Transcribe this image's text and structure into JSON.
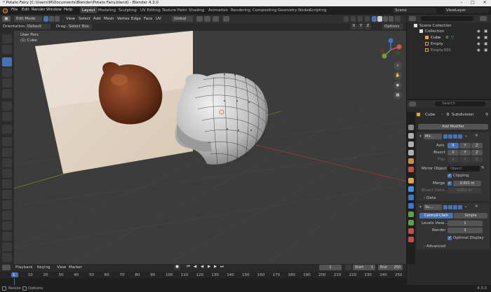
{
  "window": {
    "title": "* Potato Fairy [C:\\Users\\M\\Documents\\Blender\\Potato Fairy.blend] - Blender 4.3.0"
  },
  "menu": [
    "File",
    "Edit",
    "Render",
    "Window",
    "Help"
  ],
  "workspaces": [
    "Layout",
    "Modeling",
    "Sculpting",
    "UV Editing",
    "Texture Paint",
    "Shading",
    "Animation",
    "Rendering",
    "Compositing",
    "Geometry Nodes",
    "Scripting"
  ],
  "scene": {
    "name": "Scene",
    "view_layer": "ViewLayer"
  },
  "viewport_header": {
    "mode": "Edit Mode",
    "menus": [
      "View",
      "Select",
      "Add",
      "Mesh",
      "Vertex",
      "Edge",
      "Face",
      "UV"
    ],
    "orientation_btn": "Global",
    "axes": [
      "X",
      "Y",
      "Z"
    ],
    "options": "Options"
  },
  "tool_header": {
    "orientation_label": "Orientation:",
    "orientation": "Default",
    "drag_label": "Drag:",
    "drag": "Select Box"
  },
  "viewport_overlay": {
    "line1": "User Pers",
    "line2": "(1) Cube"
  },
  "outliner": {
    "items": [
      {
        "label": "Scene Collection"
      },
      {
        "label": "Collection"
      },
      {
        "label": "Cube"
      },
      {
        "label": "Empty"
      },
      {
        "label": "Empty.001"
      }
    ]
  },
  "properties": {
    "search_placeholder": "Search",
    "breadcrumb_object": "Cube",
    "breadcrumb_modifier": "Subdivision",
    "add_modifier": "Add Modifier",
    "mirror": {
      "name": "Mir...",
      "axis_label": "Axis",
      "bisect_label": "Bisect",
      "flip_label": "Flip",
      "axes": [
        "X",
        "Y",
        "Z"
      ],
      "mirror_object_label": "Mirror Object",
      "mirror_object_placeholder": "Object",
      "clipping_label": "Clipping",
      "merge_label": "Merge",
      "merge_value": "0.001 m",
      "bisect_dist_label": "Bisect Dista...",
      "bisect_dist_value": "0.001 m",
      "data_label": "Data"
    },
    "subdivision": {
      "name": "Su...",
      "catmull": "Catmull-Clark",
      "simple": "Simple",
      "levels_label": "Levels View...",
      "levels_value": "1",
      "render_label": "Render",
      "render_value": "2",
      "optimal_label": "Optimal Display",
      "advanced_label": "Advanced"
    }
  },
  "timeline": {
    "menus": [
      "Playback",
      "Keying",
      "View",
      "Marker"
    ],
    "current_frame": "1",
    "start_label": "Start",
    "start": "1",
    "end_label": "End",
    "end": "250",
    "ruler": [
      "1",
      "10",
      "20",
      "30",
      "40",
      "50",
      "60",
      "70",
      "80",
      "90",
      "100",
      "110",
      "120",
      "130",
      "140",
      "150",
      "160",
      "170",
      "180",
      "190",
      "200",
      "210",
      "220",
      "230",
      "240",
      "250"
    ]
  },
  "status": {
    "left": "Resize",
    "mid": "Options",
    "version": "4.3.0"
  }
}
